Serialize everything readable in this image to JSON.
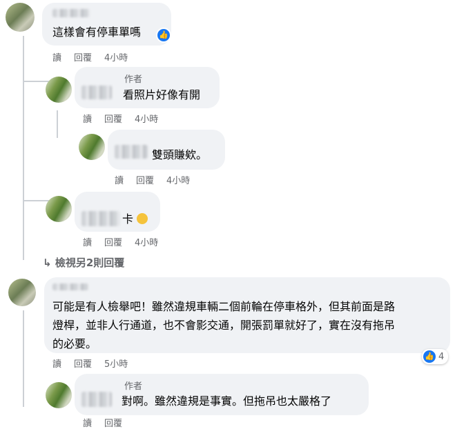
{
  "comments": [
    {
      "text": "這樣會有停車單嗎",
      "actions": {
        "read": "讀",
        "reply": "回覆",
        "time": "4小時"
      }
    },
    {
      "author_badge": "作者",
      "text": "看照片好像有開",
      "actions": {
        "read": "讀",
        "reply": "回覆",
        "time": "4小時"
      }
    },
    {
      "text": "雙頭賺欸。",
      "actions": {
        "read": "讀",
        "reply": "回覆",
        "time": "4小時"
      }
    },
    {
      "text": "卡",
      "actions": {
        "read": "讀",
        "reply": "回覆",
        "time": "4小時"
      }
    },
    {
      "text_lines": [
        "可能是有人檢舉吧！雖然違規車輛二個前輪在停車格外，但其前面是路",
        "燈桿，並非人行通道，也不會影交通，開張罰單就好了，實在沒有拖吊",
        "的必要。"
      ],
      "actions": {
        "read": "讀",
        "reply": "回覆",
        "time": "5小時"
      },
      "reaction_count": "4"
    },
    {
      "author_badge": "作者",
      "text": "對啊。雖然違規是事實。但拖吊也太嚴格了",
      "actions": {
        "read": "讀",
        "reply": "回覆"
      }
    }
  ],
  "view_more": "檢視另2則回覆",
  "colors": {
    "bubble": "#f0f2f5",
    "meta": "#65676b",
    "like": "#1877f2"
  }
}
